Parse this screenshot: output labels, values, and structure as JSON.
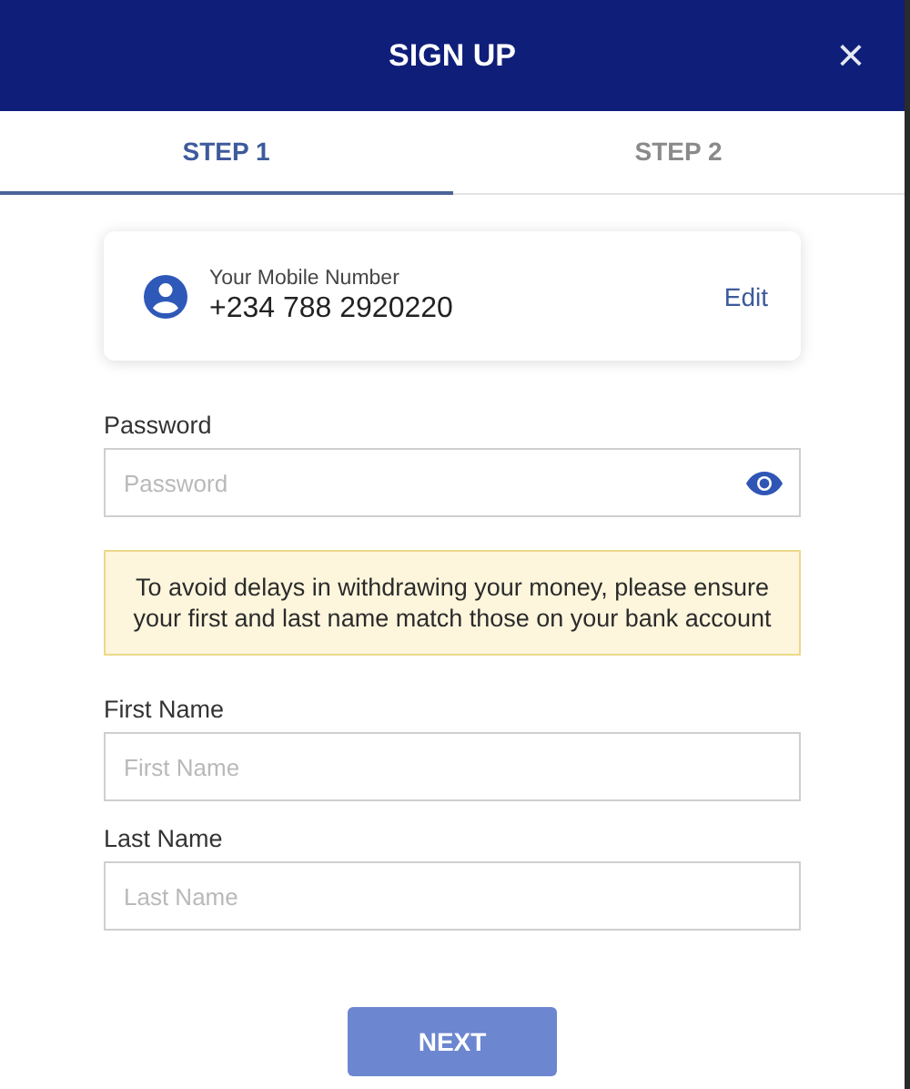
{
  "window": {
    "title": "SIGN UP",
    "close": "×"
  },
  "tabs": [
    {
      "label": "STEP 1",
      "selected": true
    },
    {
      "label": "STEP 2",
      "selected": false
    }
  ],
  "mobile_card": {
    "label": "Your Mobile Number",
    "value": "+234 788 2920220",
    "action": "Edit"
  },
  "fields": [
    {
      "kind": "password",
      "label": "Password",
      "placeholder": "Password"
    },
    {
      "kind": "notice",
      "text": "To avoid delays in withdrawing your money, please ensure your first and last name match those on your bank account"
    },
    {
      "kind": "text",
      "label": "First Name",
      "placeholder": "First Name"
    },
    {
      "kind": "text",
      "label": "Last Name",
      "placeholder": "Last Name"
    }
  ],
  "next_button": {
    "label": "NEXT",
    "disabled": true
  }
}
